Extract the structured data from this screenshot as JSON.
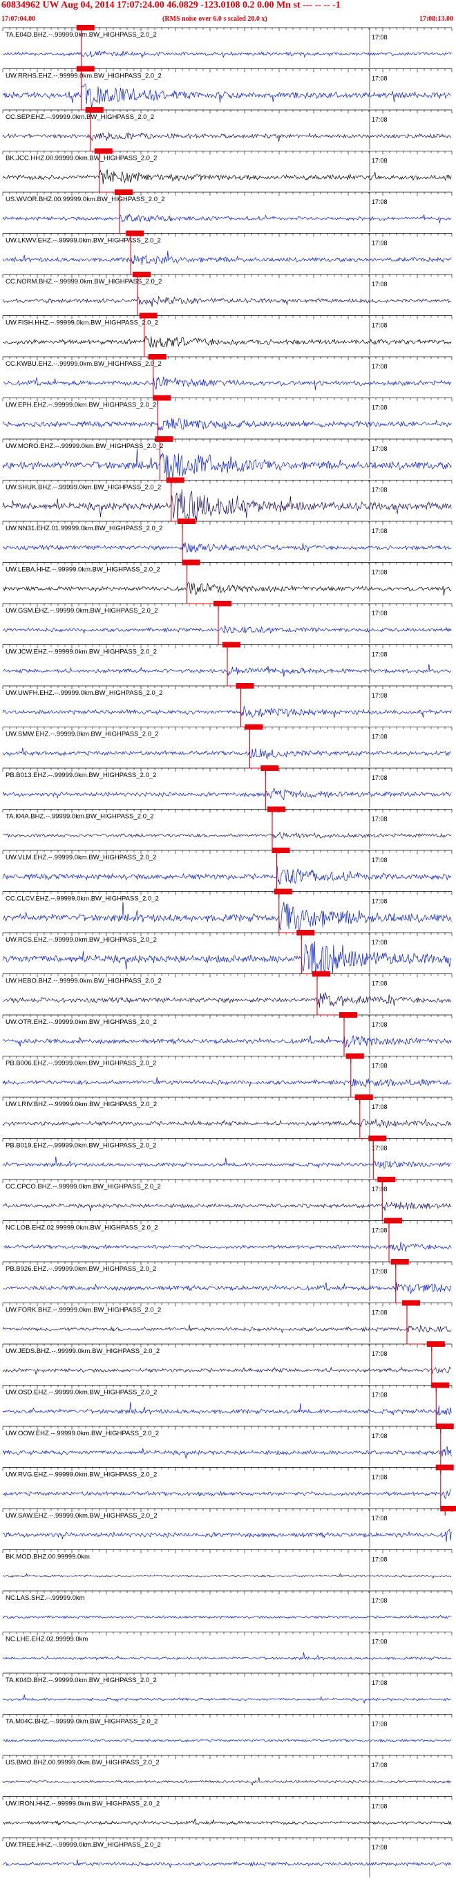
{
  "header": {
    "title": "60834962 UW Aug 04, 2014 17:07:24.00   46.0829 -123.0108  0.2 0.00 Mn st --- -- --  -1",
    "start_time": "17:07:04.00",
    "rms_note": "(RMS noise over 6.0 s scaled 20.0 x)",
    "end_time": "17:08:13.00"
  },
  "minute_tick_label": "17:08",
  "colors": {
    "header_text": "#e8000a",
    "pick_marker": "#e8000a",
    "baseline": "#0000cc",
    "grid": "#000000",
    "trace_palette": [
      "#0018e0",
      "#1a0a60",
      "#000000",
      "#0a28ff"
    ]
  },
  "channels": [
    {
      "label": "TA.E04D.BHZ.--.99999.0km.BW_HIGHPASS_2.0_2",
      "pick": 0.175,
      "amp": 0.25,
      "color": "#0018e0"
    },
    {
      "label": "UW.RRHS.EHZ.--.99999.0km.BW_HIGHPASS_2.0_2",
      "pick": 0.175,
      "amp": 0.7,
      "color": "#0018e0"
    },
    {
      "label": "CC.SEP.EHZ.--.99999.0km.BW_HIGHPASS_2.0_2",
      "pick": 0.195,
      "amp": 0.35,
      "color": "#1a0a60"
    },
    {
      "label": "BK.JCC.HHZ.00.99999.0km.BW_HIGHPASS_2.0_2",
      "pick": 0.215,
      "amp": 0.5,
      "color": "#000000"
    },
    {
      "label": "US.WVOR.BHZ.00.99999.0km.BW_HIGHPASS_2.0_2",
      "pick": 0.26,
      "amp": 0.3,
      "color": "#0018e0"
    },
    {
      "label": "UW.LKWV.EHZ.--.99999.0km.BW_HIGHPASS_2.0_2",
      "pick": 0.285,
      "amp": 0.4,
      "color": "#0018e0"
    },
    {
      "label": "CC.NORM.BHZ.--.99999.0km.BW_HIGHPASS_2.0_2",
      "pick": 0.3,
      "amp": 0.35,
      "color": "#1a0a60"
    },
    {
      "label": "UW.FISH.HHZ.--.99999.0km.BW_HIGHPASS_2.0_2",
      "pick": 0.315,
      "amp": 0.5,
      "color": "#000000"
    },
    {
      "label": "CC.KWBU.EHZ.--.99999.0km.BW_HIGHPASS_2.0_2",
      "pick": 0.335,
      "amp": 0.45,
      "color": "#0018e0"
    },
    {
      "label": "UW.EPH.EHZ.--.99999.0km.BW_HIGHPASS_2.0_2",
      "pick": 0.345,
      "amp": 0.55,
      "color": "#0018e0"
    },
    {
      "label": "UW.MORO.EHZ.--.99999.0km.BW_HIGHPASS_2.0_2",
      "pick": 0.35,
      "amp": 0.95,
      "color": "#0018e0"
    },
    {
      "label": "UW.SHUK.BHZ.--.99999.0km.BW_HIGHPASS_2.0_2",
      "pick": 0.375,
      "amp": 0.95,
      "color": "#1a0a60"
    },
    {
      "label": "UW.NN31.EHZ.01.99999.0km.BW_HIGHPASS_2.0_2",
      "pick": 0.4,
      "amp": 0.4,
      "color": "#0018e0"
    },
    {
      "label": "UW.LEBA.HHZ.--.99999.0km.BW_HIGHPASS_2.0_2",
      "pick": 0.41,
      "amp": 0.45,
      "color": "#000000"
    },
    {
      "label": "UW.GSM.EHZ.--.99999.0km.BW_HIGHPASS_2.0_2",
      "pick": 0.48,
      "amp": 0.3,
      "color": "#0018e0"
    },
    {
      "label": "UW.JCW.EHZ.--.99999.0km.BW_HIGHPASS_2.0_2",
      "pick": 0.5,
      "amp": 0.35,
      "color": "#0018e0"
    },
    {
      "label": "UW.UWFH.EHZ.--.99999.0km.BW_HIGHPASS_2.0_2",
      "pick": 0.53,
      "amp": 0.4,
      "color": "#0018e0"
    },
    {
      "label": "UW.SMW.EHZ.--.99999.0km.BW_HIGHPASS_2.0_2",
      "pick": 0.55,
      "amp": 0.4,
      "color": "#0018e0"
    },
    {
      "label": "PB.B013.EHZ.--.99999.0km.BW_HIGHPASS_2.0_2",
      "pick": 0.585,
      "amp": 0.4,
      "color": "#0018e0"
    },
    {
      "label": "TA.I04A.BHZ.--.99999.0km.BW_HIGHPASS_2.0_2",
      "pick": 0.6,
      "amp": 0.25,
      "color": "#1a0a60"
    },
    {
      "label": "UW.VLM.EHZ.--.99999.0km.BW_HIGHPASS_2.0_2",
      "pick": 0.61,
      "amp": 0.6,
      "color": "#0018e0"
    },
    {
      "label": "CC.CLCV.EHZ.--.99999.0km.BW_HIGHPASS_2.0_2",
      "pick": 0.615,
      "amp": 0.9,
      "color": "#0018e0"
    },
    {
      "label": "UW.RCS.EHZ.--.99999.0km.BW_HIGHPASS_2.0_2",
      "pick": 0.665,
      "amp": 0.95,
      "color": "#0018e0"
    },
    {
      "label": "UW.HEBO.BHZ.--.99999.0km.BW_HIGHPASS_2.0_2",
      "pick": 0.7,
      "amp": 0.5,
      "color": "#1a0a60"
    },
    {
      "label": "UW.OTR.EHZ.--.99999.0km.BW_HIGHPASS_2.0_2",
      "pick": 0.76,
      "amp": 0.45,
      "color": "#0018e0"
    },
    {
      "label": "PB.B006.EHZ.--.99999.0km.BW_HIGHPASS_2.0_2",
      "pick": 0.775,
      "amp": 0.4,
      "color": "#0018e0"
    },
    {
      "label": "UW.LRIV.BHZ.--.99999.0km.BW_HIGHPASS_2.0_2",
      "pick": 0.795,
      "amp": 0.4,
      "color": "#1a0a60"
    },
    {
      "label": "PB.B019.EHZ.--.99999.0km.BW_HIGHPASS_2.0_2",
      "pick": 0.825,
      "amp": 0.3,
      "color": "#0018e0"
    },
    {
      "label": "CC.CPCO.BHZ.--.99999.0km.BW_HIGHPASS_2.0_2",
      "pick": 0.845,
      "amp": 0.35,
      "color": "#1a0a60"
    },
    {
      "label": "NC.LOB.EHZ.02.99999.0km.BW_HIGHPASS_2.0_2",
      "pick": 0.86,
      "amp": 0.3,
      "color": "#0018e0"
    },
    {
      "label": "PB.B926.EHZ.--.99999.0km.BW_HIGHPASS_2.0_2",
      "pick": 0.875,
      "amp": 0.45,
      "color": "#0018e0"
    },
    {
      "label": "UW.FORK.BHZ.--.99999.0km.BW_HIGHPASS_2.0_2",
      "pick": 0.9,
      "amp": 0.3,
      "color": "#1a0a60"
    },
    {
      "label": "UW.JEDS.BHZ.--.99999.0km.BW_HIGHPASS_2.0_2",
      "pick": 0.955,
      "amp": 0.3,
      "color": "#1a0a60"
    },
    {
      "label": "UW.OSD.EHZ.--.99999.0km.BW_HIGHPASS_2.0_2",
      "pick": 0.965,
      "amp": 0.4,
      "color": "#0018e0"
    },
    {
      "label": "UW.OOW.EHZ.--.99999.0km.BW_HIGHPASS_2.0_2",
      "pick": 0.975,
      "amp": 0.4,
      "color": "#0018e0"
    },
    {
      "label": "UW.RVG.EHZ.--.99999.0km.BW_HIGHPASS_2.0_2",
      "pick": 0.975,
      "amp": 0.35,
      "color": "#0018e0"
    },
    {
      "label": "UW.SAW.EHZ.--.99999.0km.BW_HIGHPASS_2.0_2",
      "pick": 0.985,
      "amp": 0.45,
      "color": "#0018e0"
    },
    {
      "label": "BK.MOD.BHZ.00.99999.0km",
      "pick": null,
      "amp": 0.06,
      "color": "#1a0a60"
    },
    {
      "label": "NC.LAS.SHZ.--.99999.0km",
      "pick": null,
      "amp": 0.12,
      "color": "#0018e0"
    },
    {
      "label": "NC.LHE.EHZ.02.99999.0km",
      "pick": null,
      "amp": 0.15,
      "color": "#0018e0"
    },
    {
      "label": "TA.K04D.BHZ.--.99999.0km.BW_HIGHPASS_2.0_2",
      "pick": null,
      "amp": 0.12,
      "color": "#0018e0"
    },
    {
      "label": "TA.M04C.BHZ.--.99999.0km.BW_HIGHPASS_2.0_2",
      "pick": null,
      "amp": 0.12,
      "color": "#0018e0"
    },
    {
      "label": "US.BMO.BHZ.00.99999.0km.BW_HIGHPASS_2.0_2",
      "pick": null,
      "amp": 0.15,
      "color": "#1a0a60"
    },
    {
      "label": "UW.IRON.HHZ.--.99999.0km.BW_HIGHPASS_2.0_2",
      "pick": null,
      "amp": 0.25,
      "color": "#000000"
    },
    {
      "label": "UW.TREE.HHZ.--.99999.0km.BW_HIGHPASS_2.0_2",
      "pick": null,
      "amp": 0.3,
      "color": "#0018e0"
    }
  ]
}
